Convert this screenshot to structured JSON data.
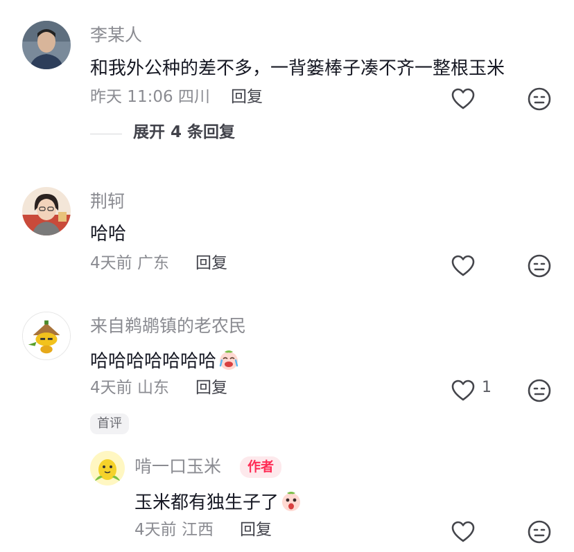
{
  "comments": [
    {
      "name": "李某人",
      "text": "和我外公种的差不多，一背篓棒子凑不齐一整根玉米",
      "meta": "昨天 11:06 四川",
      "reply_label": "回复",
      "expand_label": "展开 4 条回复"
    },
    {
      "name": "荆轲",
      "text": "哈哈",
      "meta": "4天前 广东",
      "reply_label": "回复"
    },
    {
      "name": "来自鹈鹕镇的老农民",
      "text": "哈哈哈哈哈哈哈",
      "meta": "4天前 山东",
      "reply_label": "回复",
      "like_count": "1",
      "badge": "首评"
    },
    {
      "name": "啃一口玉米",
      "author_badge": "作者",
      "text": "玉米都有独生子了",
      "meta": "4天前 江西",
      "reply_label": "回复"
    }
  ],
  "icons": {
    "like": "heart-outline-icon",
    "dislike": "neutral-face-icon",
    "emoji_laugh_cry": "laugh-cry-emoji",
    "emoji_surprised": "surprised-emoji"
  },
  "colors": {
    "name_gray": "#8a8b91",
    "text_dark": "#161823",
    "author_red": "#fe2c55"
  }
}
